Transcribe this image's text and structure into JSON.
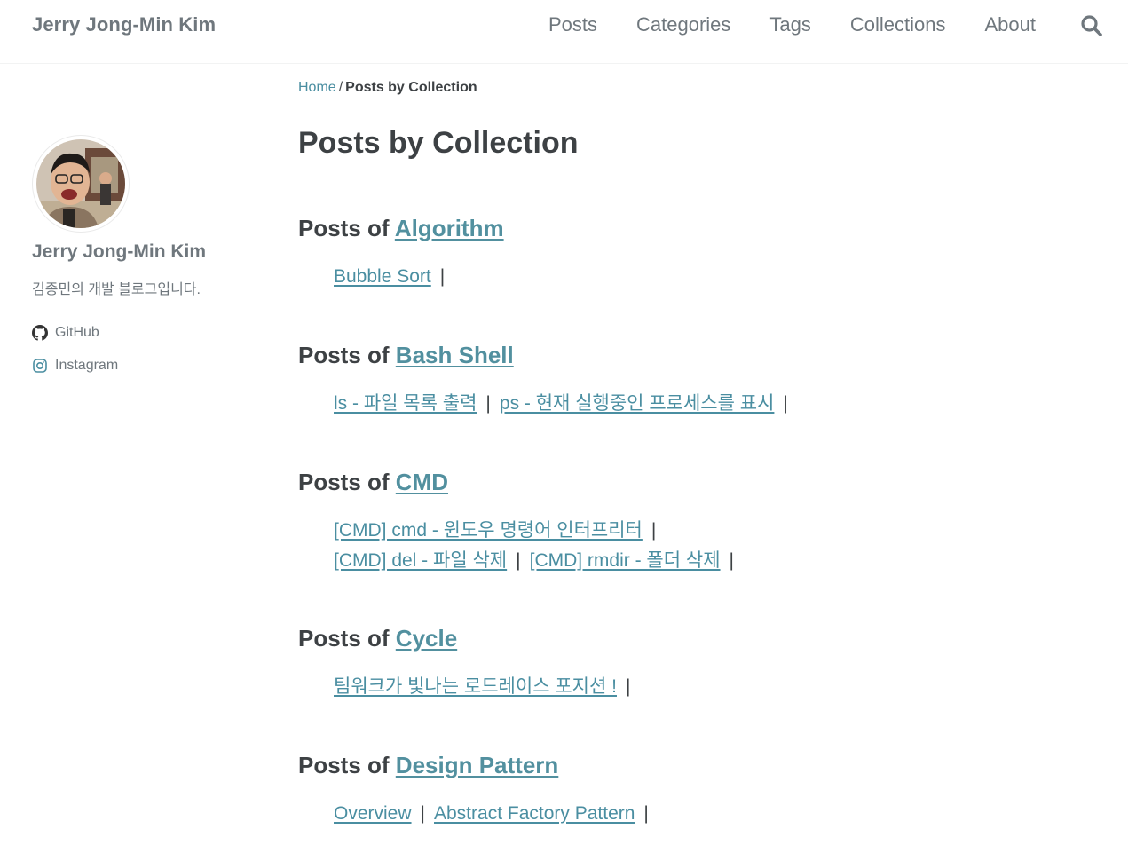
{
  "masthead": {
    "site_title": "Jerry Jong-Min Kim",
    "nav": [
      "Posts",
      "Categories",
      "Tags",
      "Collections",
      "About"
    ],
    "search_icon": "search-icon"
  },
  "sidebar": {
    "author_name": "Jerry Jong-Min Kim",
    "bio": "김종민의 개발 블로그입니다.",
    "links": [
      {
        "icon": "github-icon",
        "label": "GitHub"
      },
      {
        "icon": "instagram-icon",
        "label": "Instagram"
      }
    ]
  },
  "breadcrumb": {
    "home": "Home",
    "separator": "/",
    "current": "Posts by Collection"
  },
  "page_title": "Posts by Collection",
  "sections": [
    {
      "prefix": "Posts of",
      "name": "Algorithm",
      "posts": [
        [
          "Bubble Sort"
        ]
      ]
    },
    {
      "prefix": "Posts of",
      "name": "Bash Shell",
      "posts": [
        [
          "ls - 파일 목록 출력",
          "ps - 현재 실행중인 프로세스를 표시"
        ]
      ]
    },
    {
      "prefix": "Posts of",
      "name": "CMD",
      "posts": [
        [
          "[CMD] cmd - 윈도우 명령어 인터프리터"
        ],
        [
          "[CMD] del - 파일 삭제",
          "[CMD] rmdir - 폴더 삭제"
        ]
      ]
    },
    {
      "prefix": "Posts of",
      "name": "Cycle",
      "posts": [
        [
          "팀워크가 빛나는 로드레이스 포지션 !"
        ]
      ]
    },
    {
      "prefix": "Posts of",
      "name": "Design Pattern",
      "posts": [
        [
          "Overview",
          "Abstract Factory Pattern"
        ]
      ]
    }
  ],
  "pipe": "|",
  "colors": {
    "link": "#4a8ea1",
    "text": "#3d4144",
    "muted": "#6f777d"
  }
}
